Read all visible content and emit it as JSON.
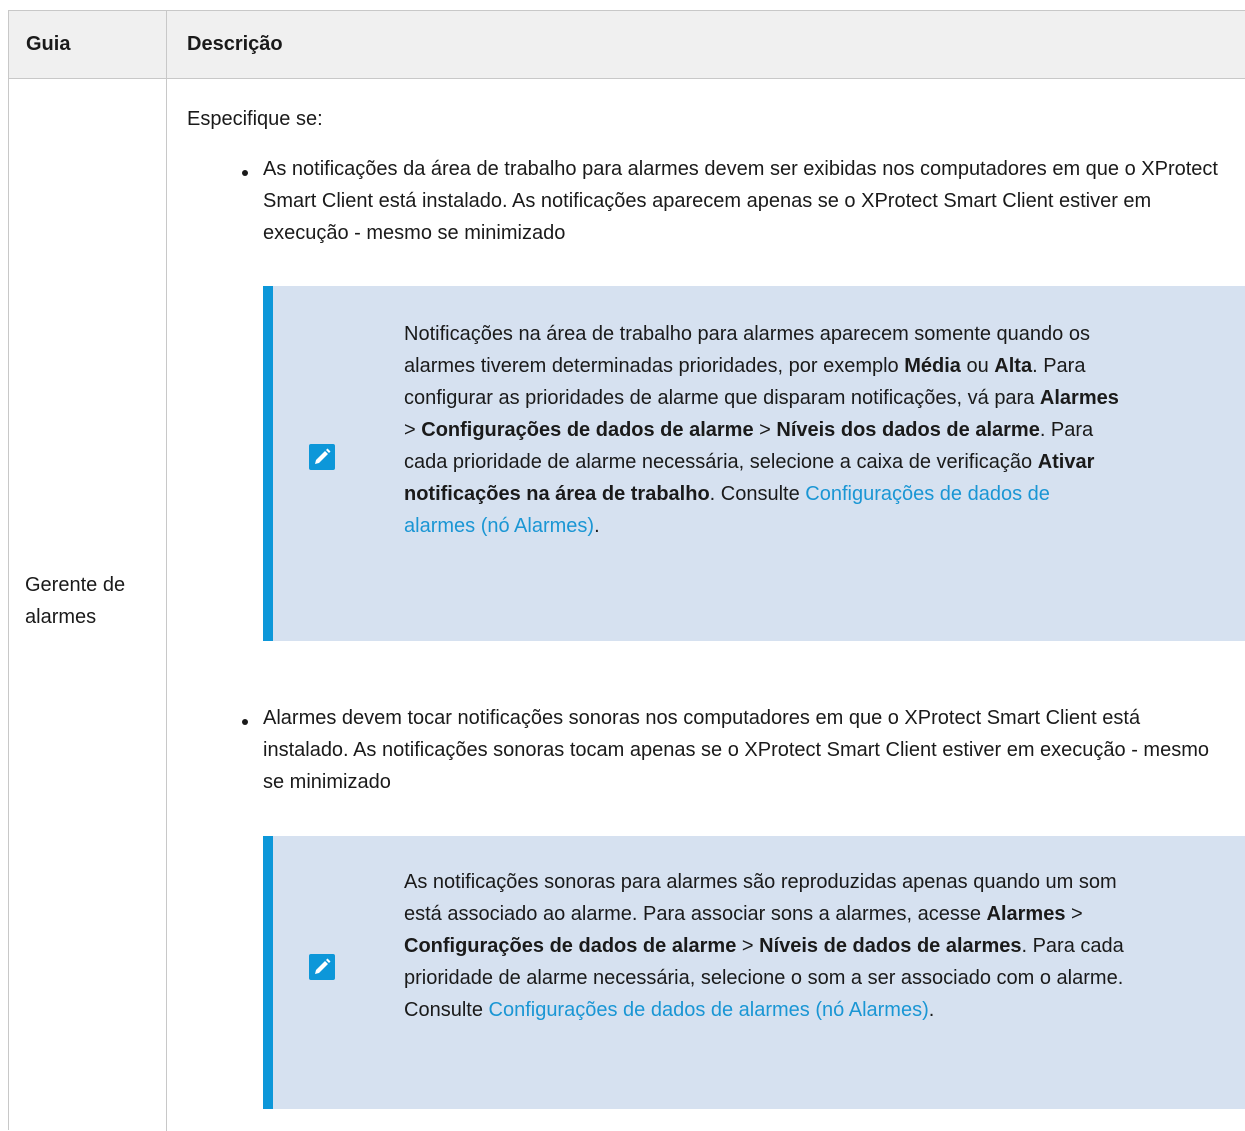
{
  "table": {
    "headers": {
      "guide": "Guia",
      "description": "Descrição"
    },
    "row": {
      "guide_label": "Gerente de alarmes",
      "intro": "Especifique se:",
      "bullets": [
        {
          "text": "As notificações da área de trabalho para alarmes devem ser exibidas nos computadores em que o XProtect Smart Client está instalado. As notificações aparecem apenas se o XProtect Smart Client estiver em execução - mesmo se minimizado",
          "note": {
            "icon": "pencil-icon",
            "t1": "Notificações na área de trabalho para alarmes aparecem somente quando os alarmes tiverem determinadas prioridades, por exemplo ",
            "b1": "Média",
            "t2": " ou ",
            "b2": "Alta",
            "t3": ". Para configurar as prioridades de alarme que disparam notificações, vá para ",
            "b3": "Alarmes",
            "t4": " > ",
            "b4": "Configurações de dados de alarme",
            "t5": " > ",
            "b5": "Níveis dos dados de alarme",
            "t6": ". Para cada prioridade de alarme necessária, selecione a caixa de verificação ",
            "b6": "Ativar notificações na área de trabalho",
            "t7": ". Consulte ",
            "link": "Configurações de dados de alarmes (nó Alarmes)",
            "t8": "."
          }
        },
        {
          "text": "Alarmes devem tocar notificações sonoras nos computadores em que o XProtect Smart Client está instalado. As notificações sonoras tocam apenas se o XProtect Smart Client estiver em execução - mesmo se minimizado",
          "note": {
            "icon": "pencil-icon",
            "t1": "As notificações sonoras para alarmes são reproduzidas apenas quando um som está associado ao alarme. Para associar sons a alarmes, acesse ",
            "b1": "Alarmes",
            "t2": " > ",
            "b2": "Configurações de dados de alarme",
            "t3": " > ",
            "b3": "Níveis de dados de alarmes",
            "t4": ". Para cada prioridade de alarme necessária, selecione o som a ser associado com o alarme. Consulte ",
            "link": "Configurações de dados de alarmes (nó Alarmes)",
            "t5": "."
          }
        }
      ]
    }
  },
  "colors": {
    "accent": "#0d97d9",
    "note_bg": "#d6e1f0",
    "link": "#1a96d4"
  }
}
